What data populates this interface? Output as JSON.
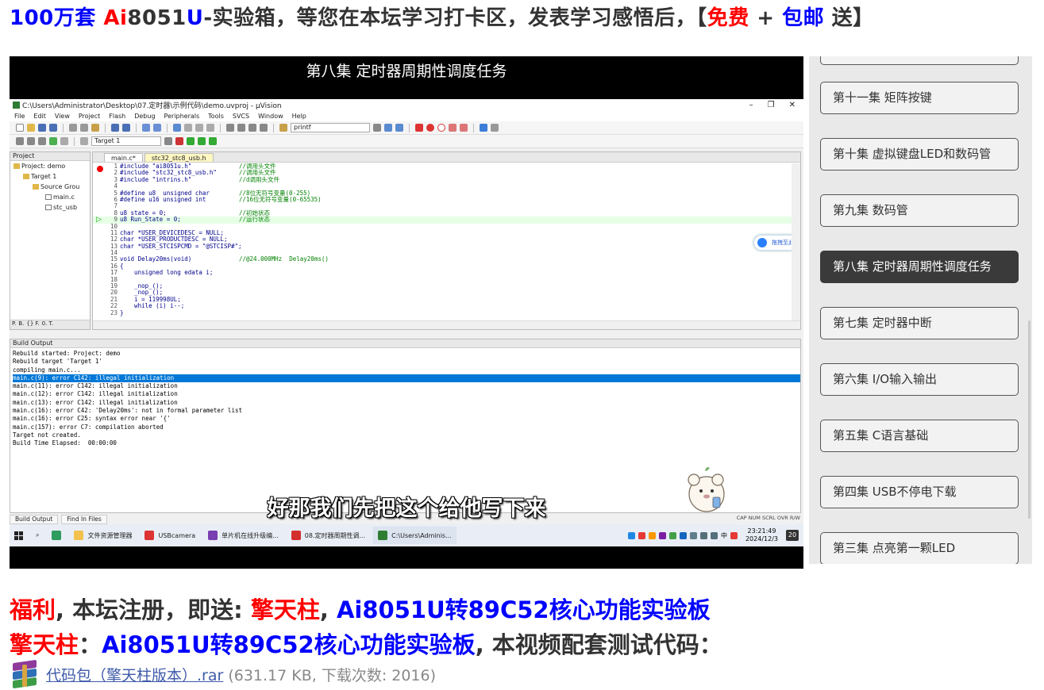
{
  "top_banner": {
    "count": "100万套",
    "ai": "Ai",
    "chip_num": "8051",
    "chip_u": "U",
    "text1": "-实验箱，等您在本坛学习打卡区，发表学习感悟后，【",
    "free": "免费",
    "plus": " + ",
    "shipping": "包邮",
    "text2": " 送】"
  },
  "video": {
    "title": "第八集 定时器周期性调度任务",
    "subtitle": "好那我们先把这个给他写下来",
    "ide": {
      "window_title": "C:\\Users\\Administrator\\Desktop\\07.定时器\\示例代码\\demo.uvproj - µVision",
      "window_buttons": [
        "–",
        "❐",
        "✕"
      ],
      "menu": [
        "File",
        "Edit",
        "View",
        "Project",
        "Flash",
        "Debug",
        "Peripherals",
        "Tools",
        "SVCS",
        "Window",
        "Help"
      ],
      "toolbar_combo": "printf",
      "target_combo": "Target 1",
      "project_panel_title": "Project",
      "tree": [
        "Project: demo",
        "Target 1",
        "Source Grou",
        "main.c",
        "stc_usb"
      ],
      "panel_tabs": [
        "P.",
        "B.",
        "{} F.",
        "0. T."
      ],
      "tabs": [
        "main.c*",
        "stc32_stc8_usb.h"
      ],
      "code_lines": [
        {
          "n": "1",
          "code": "#include \"ai8051u.h\"",
          "comment": "//调用头文件"
        },
        {
          "n": "2",
          "code": "#include \"stc32_stc8_usb.h\"",
          "comment": "//调用头文件"
        },
        {
          "n": "3",
          "code": "#include \"intrins.h\"",
          "comment": "//d调用头文件"
        },
        {
          "n": "4",
          "code": "",
          "comment": ""
        },
        {
          "n": "5",
          "code": "#define u8  unsigned char",
          "comment": "//8位无符号变量(0-255)"
        },
        {
          "n": "6",
          "code": "#define u16 unsigned int",
          "comment": "//16位无符号变量(0-65535)"
        },
        {
          "n": "7",
          "code": "",
          "comment": ""
        },
        {
          "n": "8",
          "code": "u8 state = 0;",
          "comment": "//初始状态"
        },
        {
          "n": "9",
          "code": "u8 Run_State = 0;",
          "comment": "//运行状态"
        },
        {
          "n": "10",
          "code": "",
          "comment": ""
        },
        {
          "n": "11",
          "code": "char *USER_DEVICEDESC = NULL;",
          "comment": ""
        },
        {
          "n": "12",
          "code": "char *USER_PRODUCTDESC = NULL;",
          "comment": ""
        },
        {
          "n": "13",
          "code": "char *USER_STCISPCMD = \"@STCISP#\";",
          "comment": ""
        },
        {
          "n": "14",
          "code": "",
          "comment": ""
        },
        {
          "n": "15",
          "code": "void Delay20ms(void)",
          "comment": "//@24.000MHz  Delay20ms()"
        },
        {
          "n": "16",
          "code": "{",
          "comment": ""
        },
        {
          "n": "17",
          "code": "    unsigned long edata i;",
          "comment": ""
        },
        {
          "n": "18",
          "code": "",
          "comment": ""
        },
        {
          "n": "19",
          "code": "    _nop_();",
          "comment": ""
        },
        {
          "n": "20",
          "code": "    _nop_();",
          "comment": ""
        },
        {
          "n": "21",
          "code": "    i = 119998UL;",
          "comment": ""
        },
        {
          "n": "22",
          "code": "    while (i) i--;",
          "comment": ""
        },
        {
          "n": "23",
          "code": "}",
          "comment": ""
        }
      ],
      "baidu_badge": "拖拽至此上传",
      "build_title": "Build Output",
      "build_lines": [
        "Rebuild started: Project: demo",
        "Rebuild target 'Target 1'",
        "compiling main.c...",
        "main.c(9): error C142: illegal initialization",
        "main.c(11): error C142: illegal initialization",
        "main.c(12): error C142: illegal initialization",
        "main.c(13): error C142: illegal initialization",
        "main.c(16): error C42: 'Delay20ms': not in formal parameter list",
        "main.c(16): error C25: syntax error near '{'",
        "main.c(157): error C7: compilation aborted",
        "Target not created.",
        "Build Time Elapsed:  00:00:00"
      ],
      "selected_build_line": 3,
      "bottom_tabs": [
        "Build Output",
        "Find In Files"
      ],
      "status": "CAP  NUM  SCRL  OVR  R/W"
    },
    "taskbar": {
      "items": [
        "文件资源管理器",
        "USBcamera",
        "单片机在线升级编...",
        "08.定时器周期性调...",
        "C:\\Users\\Adminis..."
      ],
      "ime": "中",
      "time": "23:21:49",
      "date": "2024/12/3",
      "notif_count": "20"
    }
  },
  "episodes": {
    "items": [
      {
        "label": "第十一集 矩阵按键",
        "active": false
      },
      {
        "label": "第十集 虚拟键盘LED和数码管",
        "active": false
      },
      {
        "label": "第九集 数码管",
        "active": false
      },
      {
        "label": "第八集 定时器周期性调度任务",
        "active": true
      },
      {
        "label": "第七集 定时器中断",
        "active": false
      },
      {
        "label": "第六集 I/O输入输出",
        "active": false
      },
      {
        "label": "第五集 C语言基础",
        "active": false
      },
      {
        "label": "第四集 USB不停电下载",
        "active": false
      },
      {
        "label": "第三集 点亮第一颗LED",
        "active": false
      }
    ]
  },
  "promo": {
    "line1": {
      "welfare": "福利",
      "text1": ", 本坛注册，即送: ",
      "pillar": "擎天柱",
      "comma": ", ",
      "board": "Ai8051U转89C52核心功能实验板"
    },
    "line2": {
      "pillar": "擎天柱",
      "colon": "：",
      "board": "Ai8051U转89C52核心功能实验板",
      "text": ", 本视频配套测试代码："
    }
  },
  "attachment": {
    "name": "代码包（擎天柱版本）.rar",
    "meta": "(631.17 KB, 下载次数: 2016)"
  },
  "colors": {
    "blue": "#0000ff",
    "red": "#ff0000",
    "active_episode_bg": "#3a3a3a",
    "link": "#3f5ba9"
  }
}
